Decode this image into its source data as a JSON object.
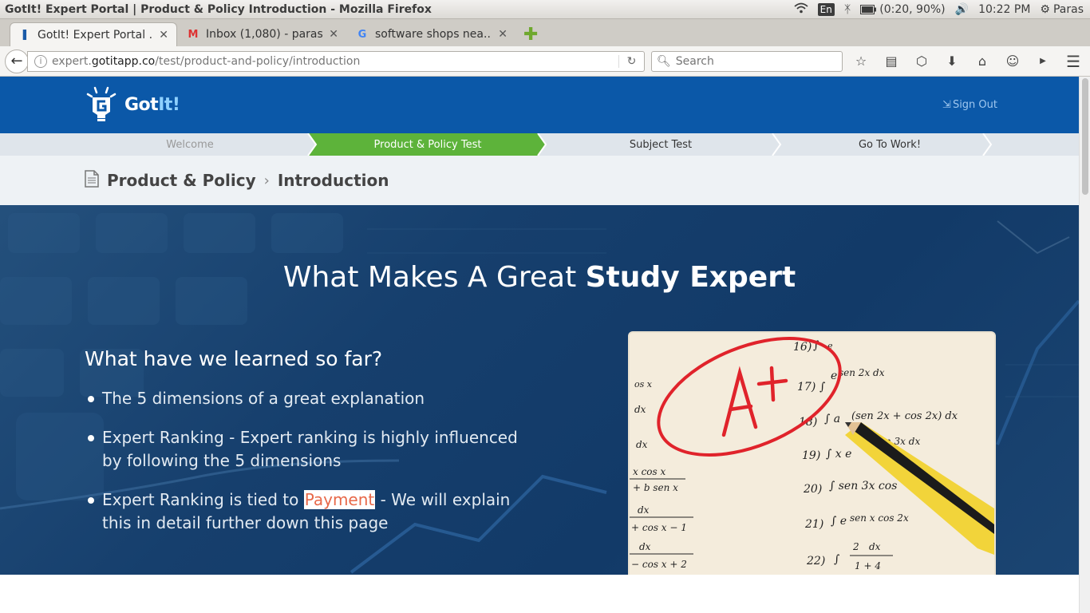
{
  "os": {
    "window_title": "GotIt! Expert Portal | Product & Policy Introduction - Mozilla Firefox",
    "keyboard": "En",
    "battery": "(0:20, 90%)",
    "clock": "10:22 PM",
    "user": "Paras"
  },
  "browser": {
    "tabs": [
      {
        "label": "GotIt! Expert Portal ...",
        "active": true
      },
      {
        "label": "Inbox (1,080) - paras...",
        "active": false
      },
      {
        "label": "software shops nea...",
        "active": false
      }
    ],
    "url_prefix": "expert.",
    "url_host": "gotitapp.co",
    "url_path": "/test/product-and-policy/introduction",
    "search_placeholder": "Search"
  },
  "header": {
    "logo_text_a": "Got",
    "logo_text_b": "It!",
    "signout_label": "Sign Out"
  },
  "progress": {
    "steps": [
      {
        "label": "Welcome",
        "state": "done"
      },
      {
        "label": "Product & Policy Test",
        "state": "active"
      },
      {
        "label": "Subject Test",
        "state": "todo"
      },
      {
        "label": "Go To Work!",
        "state": "todo"
      }
    ],
    "active_color": "#5db33a"
  },
  "breadcrumb": {
    "section": "Product & Policy",
    "page": "Introduction"
  },
  "hero": {
    "title_regular": "What Makes A Great ",
    "title_bold": "Study Expert",
    "subheading": "What have we learned so far?",
    "bullets": [
      "The 5 dimensions of a great explanation",
      "Expert Ranking - Expert ranking is highly influenced by following the 5 dimensions"
    ],
    "bullet3_before": "Expert Ranking is tied to ",
    "bullet3_link": "Payment",
    "bullet3_after": " - We will explain this in detail further down this page"
  },
  "colors": {
    "header_blue": "#0b58a8",
    "link_orange": "#e8694a"
  }
}
